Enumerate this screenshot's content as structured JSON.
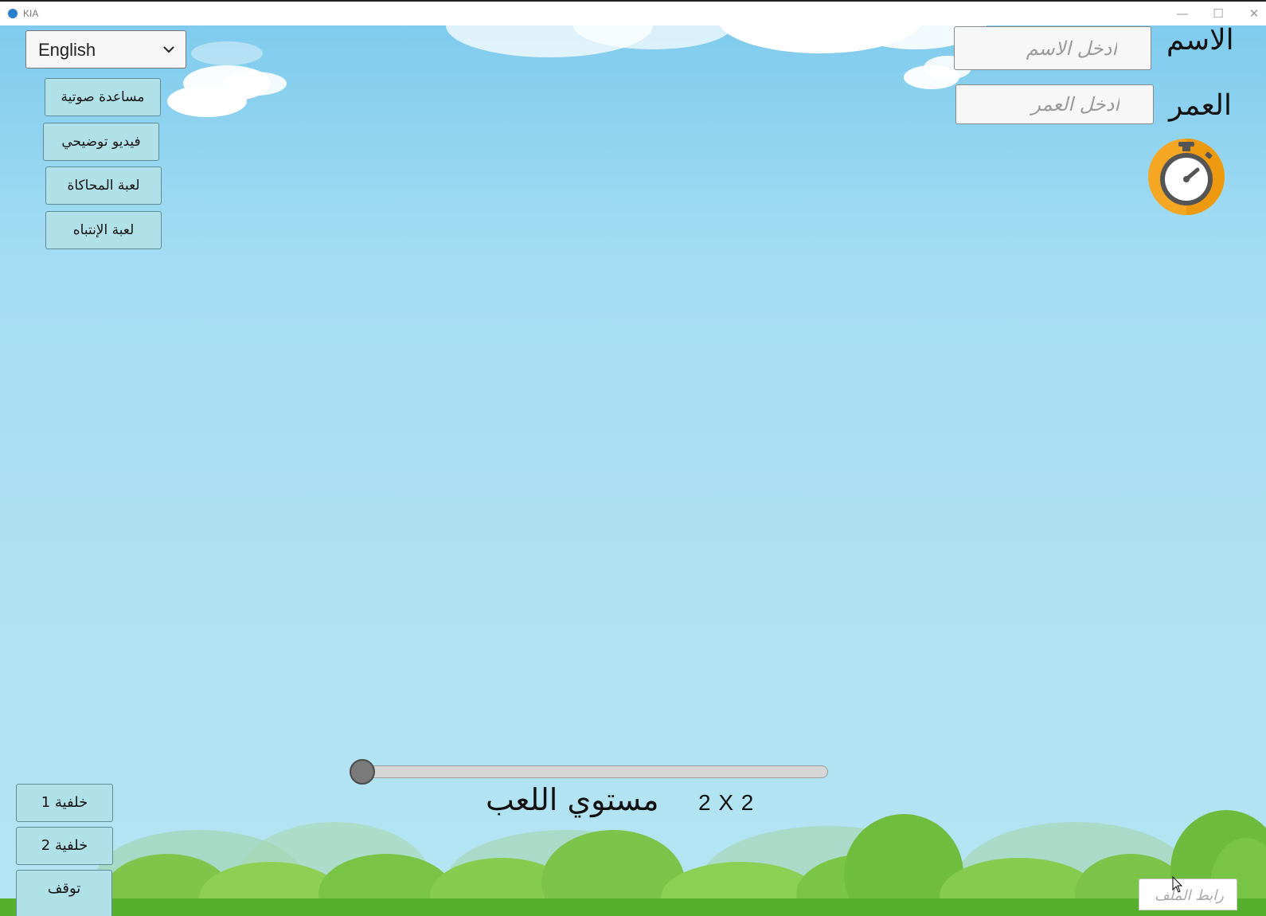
{
  "window": {
    "title": "KIA",
    "minimize_glyph": "—",
    "maximize_glyph": "☐",
    "close_glyph": "✕"
  },
  "language_select": {
    "value": "English"
  },
  "side_buttons": [
    {
      "label": "مساعدة صوتية"
    },
    {
      "label": "فيديو توضيحي"
    },
    {
      "label": "لعبة المحاكاة"
    },
    {
      "label": "لعبة الإنتباه"
    }
  ],
  "form": {
    "name_label": "الاسم",
    "name_placeholder": "ادخل الاسم",
    "age_label": "العمر",
    "age_placeholder": "ادخل العمر"
  },
  "timer": {
    "icon": "stopwatch-icon",
    "color": "#f5a623"
  },
  "level": {
    "label": "مستوي اللعب",
    "value": "2 X 2",
    "slider_position": 0
  },
  "background_buttons": [
    {
      "label": "خلفية 1"
    },
    {
      "label": "خلفية 2"
    }
  ],
  "stop_button": {
    "label": "توقف"
  },
  "file_link": {
    "label": "رابط الملف"
  },
  "colors": {
    "sky": "#ade1f2",
    "button": "#b0e1e9",
    "grass": "#56b02c",
    "timer": "#f5a623"
  }
}
